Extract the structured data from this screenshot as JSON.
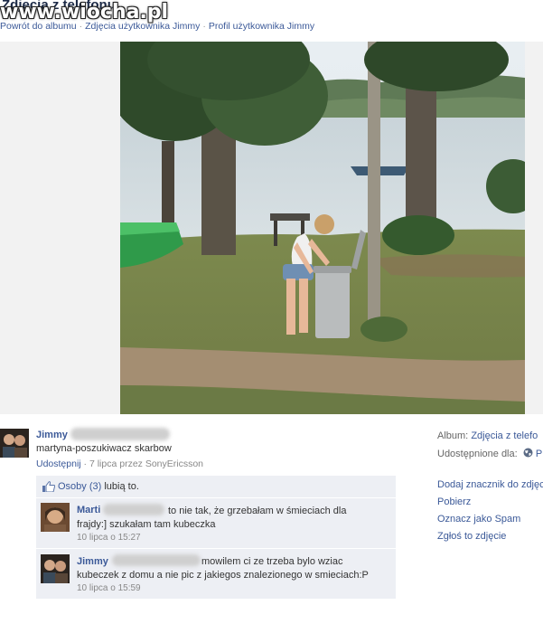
{
  "header": {
    "album_title": "Zdjęcia z telefonu",
    "watermark": "www.wiocha.pl",
    "breadcrumb": [
      "Powrót do albumu",
      "Zdjęcia użytkownika Jimmy",
      "Profil użytkownika Jimmy"
    ]
  },
  "post": {
    "owner_name": "Jimmy",
    "caption": "martyna-poszukiwacz skarbow",
    "share_label": "Udostępnij",
    "meta": "7 lipca przez SonyEricsson"
  },
  "likes": {
    "icon": "thumbs-up-icon",
    "people_label": "Osoby (3)",
    "suffix": "lubią to."
  },
  "comments": [
    {
      "author": "Marti",
      "line1": "to nie tak, że grzebałam w śmieciach dla",
      "line2": "frajdy:] szukałam tam kubeczka",
      "time": "10 lipca o 15:27"
    },
    {
      "author": "Jimmy",
      "line1": "mowilem ci ze trzeba bylo wziac",
      "line2": "kubeczek z domu a nie pic z jakiegos znalezionego w smieciach:P",
      "time": "10 lipca o 15:59"
    }
  ],
  "sidebar": {
    "album_label": "Album:",
    "album_value": "Zdjęcia z telefo",
    "shared_label": "Udostępnione dla:",
    "shared_icon": "globe-icon",
    "shared_value": "P",
    "actions": [
      "Dodaj znacznik do zdjęc",
      "Pobierz",
      "Oznacz jako Spam",
      "Zgłoś to zdjęcie"
    ]
  },
  "colors": {
    "link": "#3b5998",
    "feedback_bg": "#edeff4",
    "stage_bg": "#f2f2f2"
  }
}
